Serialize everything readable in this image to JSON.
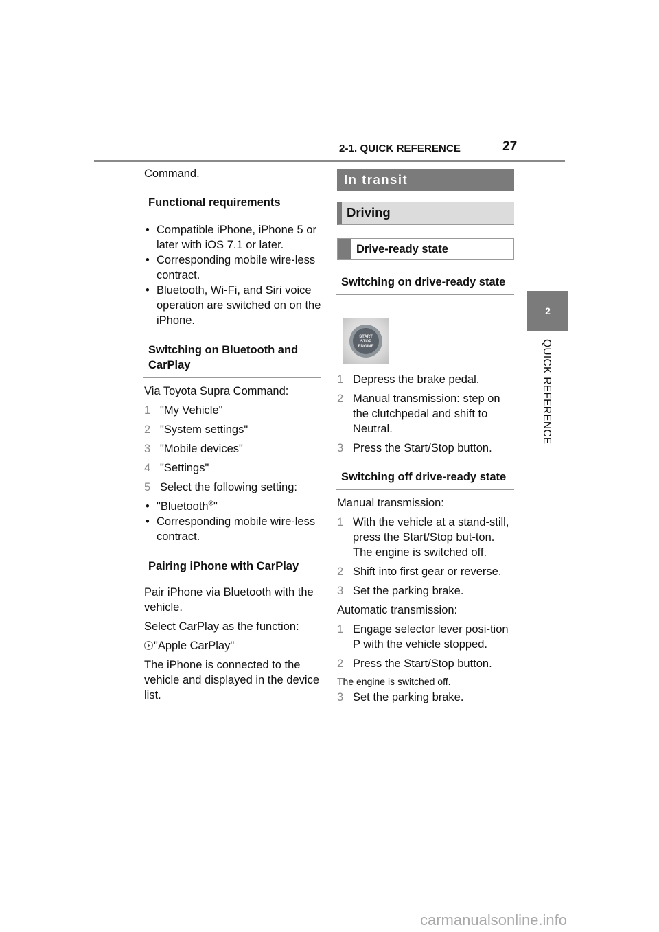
{
  "header": {
    "section": "2-1. QUICK REFERENCE",
    "page_number": "27"
  },
  "side_tab": {
    "chapter_number": "2",
    "chapter_label": "QUICK REFERENCE"
  },
  "left_column": {
    "intro_text": "Command.",
    "functional_requirements": {
      "heading": "Functional requirements",
      "bullets": [
        "Compatible iPhone, iPhone 5 or later with iOS 7.1 or later.",
        "Corresponding mobile wire-less contract.",
        "Bluetooth, Wi-Fi, and Siri voice operation are switched on on the iPhone."
      ]
    },
    "switching_on_bluetooth": {
      "heading": "Switching on Bluetooth and CarPlay",
      "intro": "Via Toyota Supra Command:",
      "steps": [
        {
          "num": "1",
          "text": "\"My Vehicle\""
        },
        {
          "num": "2",
          "text": "\"System settings\""
        },
        {
          "num": "3",
          "text": "\"Mobile devices\""
        },
        {
          "num": "4",
          "text": "\"Settings\""
        },
        {
          "num": "5",
          "text": "Select the following setting:"
        }
      ],
      "bullet_1_text": "\"Bluetooth",
      "bullet_1_sup": "®",
      "bullet_1_end": "\"",
      "bullet_2": "Corresponding mobile wire-less contract."
    },
    "pairing": {
      "heading": "Pairing iPhone with CarPlay",
      "para_1": "Pair iPhone via Bluetooth with the vehicle.",
      "para_2": "Select CarPlay as the function:",
      "menu_item_icon": "arrow-right-circle-icon",
      "menu_item": "\"Apple CarPlay\"",
      "para_3": "The iPhone is connected to the vehicle and displayed in the device list."
    }
  },
  "right_column": {
    "banner_main": "In transit",
    "banner_sub": "Driving",
    "banner_box": "Drive-ready state",
    "switching_on": {
      "heading": "Switching on drive-ready state",
      "image_label_lines": [
        "START",
        "STOP",
        "ENGINE"
      ],
      "steps": [
        {
          "num": "1",
          "text": "Depress the brake pedal."
        },
        {
          "num": "2",
          "text": "Manual transmission: step on the clutchpedal and shift to Neutral."
        },
        {
          "num": "3",
          "text": "Press the Start/Stop button."
        }
      ]
    },
    "switching_off": {
      "heading": "Switching off drive-ready state",
      "manual_label": "Manual transmission:",
      "manual_steps": [
        {
          "num": "1",
          "text": "With the vehicle at a stand-still, press the Start/Stop but-ton.",
          "note": "The engine is switched off."
        },
        {
          "num": "2",
          "text": "Shift into first gear or reverse."
        },
        {
          "num": "3",
          "text": "Set the parking brake."
        }
      ],
      "automatic_label": "Automatic transmission:",
      "automatic_steps": [
        {
          "num": "1",
          "text": "Engage selector lever posi-tion P with the vehicle stopped."
        },
        {
          "num": "2",
          "text": "Press the Start/Stop button."
        }
      ],
      "automatic_note": "The engine is switched off.",
      "automatic_final_step": {
        "num": "3",
        "text": "Set the parking brake."
      }
    }
  },
  "watermark": "carmanualsonline.info"
}
